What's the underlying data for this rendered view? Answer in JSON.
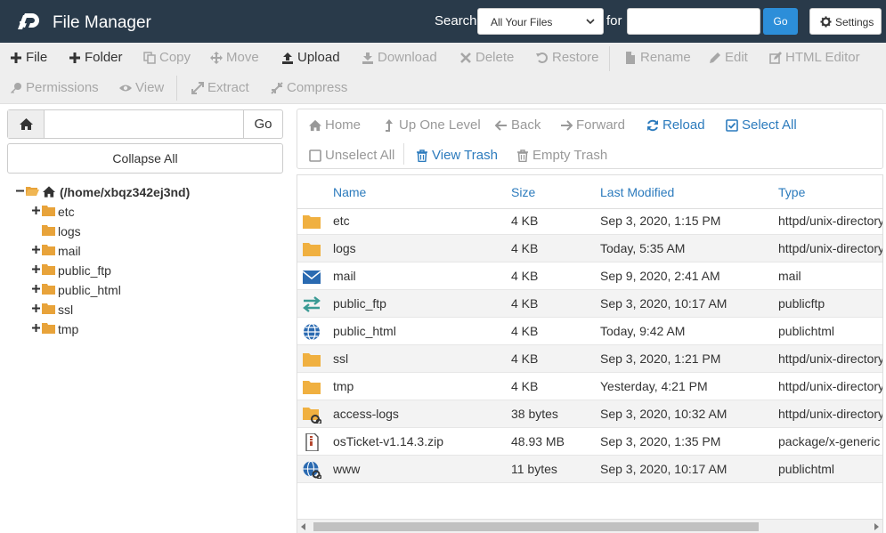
{
  "header": {
    "title": "File Manager",
    "search_label": "Search",
    "search_scope": "All Your Files",
    "for_label": "for",
    "search_value": "",
    "go_label": "Go",
    "settings_label": "Settings",
    "bg_color": "#293a4a",
    "go_color": "#2c8ed9"
  },
  "toolbar": {
    "file": "File",
    "folder": "Folder",
    "copy": "Copy",
    "move": "Move",
    "upload": "Upload",
    "download": "Download",
    "delete": "Delete",
    "restore": "Restore",
    "rename": "Rename",
    "edit": "Edit",
    "html_editor": "HTML Editor",
    "permissions": "Permissions",
    "view": "View",
    "extract": "Extract",
    "compress": "Compress"
  },
  "sidebar": {
    "path_value": "",
    "go_label": "Go",
    "collapse_label": "Collapse All",
    "root": "(/home/xbqz342ej3nd)",
    "items": [
      "etc",
      "logs",
      "mail",
      "public_ftp",
      "public_html",
      "ssl",
      "tmp"
    ]
  },
  "nav": {
    "home": "Home",
    "up_one_level": "Up One Level",
    "back": "Back",
    "forward": "Forward",
    "reload": "Reload",
    "select_all": "Select All",
    "unselect_all": "Unselect All",
    "view_trash": "View Trash",
    "empty_trash": "Empty Trash"
  },
  "table": {
    "columns": [
      "Name",
      "Size",
      "Last Modified",
      "Type"
    ],
    "rows": [
      {
        "icon": "folder-icon",
        "name": "etc",
        "size": "4 KB",
        "modified": "Sep 3, 2020, 1:15 PM",
        "type": "httpd/unix-directory"
      },
      {
        "icon": "folder-icon",
        "name": "logs",
        "size": "4 KB",
        "modified": "Today, 5:35 AM",
        "type": "httpd/unix-directory"
      },
      {
        "icon": "envelope-icon",
        "name": "mail",
        "size": "4 KB",
        "modified": "Sep 9, 2020, 2:41 AM",
        "type": "mail"
      },
      {
        "icon": "transfer-arrows-icon",
        "name": "public_ftp",
        "size": "4 KB",
        "modified": "Sep 3, 2020, 10:17 AM",
        "type": "publicftp"
      },
      {
        "icon": "globe-icon",
        "name": "public_html",
        "size": "4 KB",
        "modified": "Today, 9:42 AM",
        "type": "publichtml"
      },
      {
        "icon": "folder-icon",
        "name": "ssl",
        "size": "4 KB",
        "modified": "Sep 3, 2020, 1:21 PM",
        "type": "httpd/unix-directory"
      },
      {
        "icon": "folder-icon",
        "name": "tmp",
        "size": "4 KB",
        "modified": "Yesterday, 4:21 PM",
        "type": "httpd/unix-directory"
      },
      {
        "icon": "folder-link-icon",
        "name": "access-logs",
        "size": "38 bytes",
        "modified": "Sep 3, 2020, 10:32 AM",
        "type": "httpd/unix-directory"
      },
      {
        "icon": "zip-file-icon",
        "name": "osTicket-v1.14.3.zip",
        "size": "48.93 MB",
        "modified": "Sep 3, 2020, 1:35 PM",
        "type": "package/x-generic"
      },
      {
        "icon": "globe-link-icon",
        "name": "www",
        "size": "11 bytes",
        "modified": "Sep 3, 2020, 10:17 AM",
        "type": "publichtml"
      }
    ]
  }
}
